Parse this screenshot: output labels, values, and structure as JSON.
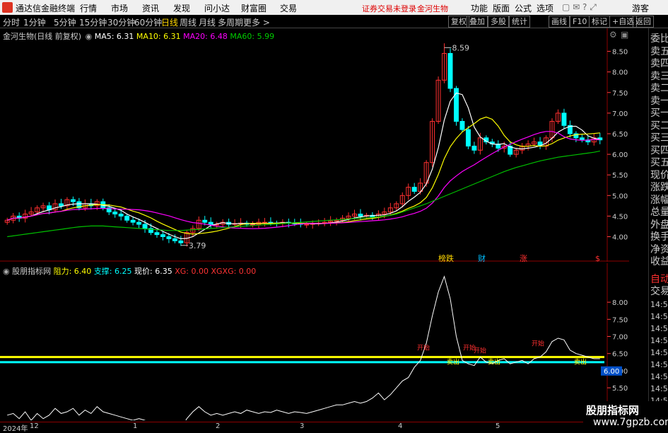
{
  "menu": {
    "app_title": "通达信金融终端",
    "items": [
      "行情",
      "市场",
      "资讯",
      "发现",
      "问小达",
      "财富圈",
      "交易"
    ],
    "notice": "证券交易未登录",
    "stock_link": "金河生物",
    "right_items": [
      "功能",
      "版面",
      "公式",
      "选项"
    ],
    "guest": "游客"
  },
  "timeframes": [
    "分时",
    "1分钟",
    "5分钟",
    "15分钟",
    "30分钟",
    "60分钟",
    "日线",
    "周线",
    "月线",
    "多周期",
    "更多 >"
  ],
  "active_timeframe": "日线",
  "tools": [
    "复权",
    "叠加",
    "多股",
    "统计",
    "画线",
    "F10",
    "标记",
    "+自选",
    "返回"
  ],
  "main_legend": {
    "title": "金河生物(日线 前复权)",
    "ma5": "MA5: 6.31",
    "ma10": "MA10: 6.31",
    "ma20": "MA20: 6.48",
    "ma60": "MA60: 5.99"
  },
  "annotations": {
    "high": "8.59",
    "low": "3.79"
  },
  "event_markers": [
    "榜跌",
    "财",
    "涨",
    "$"
  ],
  "indicator_legend": {
    "name": "股朋指标网",
    "resist": "阻力: 6.40",
    "support": "支撑: 6.25",
    "price": "现价: 6.35",
    "xg": "XG: 0.00",
    "xgxg": "XGXG: 0.00"
  },
  "indicator_tags": [
    "开始",
    "开始",
    "开始",
    "开始",
    "卖出",
    "卖出",
    "卖出"
  ],
  "current_value_badge": "6.00",
  "main_y_ticks": [
    "8.50",
    "8.00",
    "7.50",
    "7.00",
    "6.50",
    "6.00",
    "5.50",
    "5.00",
    "4.50",
    "4.00"
  ],
  "ind_y_ticks": [
    "8.00",
    "7.50",
    "7.00",
    "6.50",
    "6.00",
    "5.50",
    "5.00"
  ],
  "right_panel": {
    "order_labels": [
      "委比",
      "卖五",
      "卖四",
      "卖三",
      "卖二",
      "卖一",
      "买一",
      "买二",
      "买三",
      "买四",
      "买五",
      "现价",
      "涨跌",
      "涨幅",
      "总量",
      "外盘",
      "换手",
      "净资",
      "收益"
    ],
    "auto": "自动",
    "trade": "交易",
    "ticks": [
      "14:56",
      "14:56",
      "14:56",
      "14:56",
      "14:56",
      "14:56",
      "14:56",
      "14:56",
      "14:56",
      "14:56",
      "14:56"
    ]
  },
  "bottom_dates": [
    "2024年",
    "12",
    "1",
    "2",
    "3",
    "4",
    "5"
  ],
  "watermark": {
    "name": "股朋指标网",
    "url": "www.7gpzb.com"
  },
  "colors": {
    "up": "#ff3030",
    "down": "#00ffff",
    "ma5": "#ffffff",
    "ma10": "#ffff00",
    "ma20": "#ff00ff",
    "ma60": "#00c000",
    "resist": "#ffff00",
    "support": "#00ffff",
    "tick": "#ff4040",
    "accent": "#ff3030"
  },
  "chart_data": {
    "type": "candlestick",
    "price_range": [
      3.7,
      8.75
    ],
    "closes": [
      4.4,
      4.5,
      4.45,
      4.55,
      4.6,
      4.7,
      4.75,
      4.65,
      4.8,
      4.75,
      4.9,
      4.85,
      4.7,
      4.8,
      4.75,
      4.85,
      4.7,
      4.6,
      4.55,
      4.5,
      4.4,
      4.35,
      4.3,
      4.2,
      4.1,
      4.05,
      4.0,
      3.95,
      3.9,
      3.85,
      4.1,
      4.2,
      4.4,
      4.35,
      4.3,
      4.3,
      4.35,
      4.3,
      4.32,
      4.33,
      4.3,
      4.3,
      4.35,
      4.35,
      4.33,
      4.32,
      4.35,
      4.33,
      4.32,
      4.3,
      4.3,
      4.32,
      4.33,
      4.35,
      4.38,
      4.4,
      4.45,
      4.5,
      4.55,
      4.5,
      4.52,
      4.48,
      4.55,
      4.6,
      4.7,
      4.8,
      5.0,
      5.2,
      5.1,
      5.3,
      5.8,
      6.8,
      7.8,
      8.45,
      7.6,
      6.8,
      6.6,
      6.2,
      6.1,
      6.4,
      6.3,
      6.25,
      6.15,
      6.2,
      6.0,
      6.1,
      6.2,
      6.25,
      6.3,
      6.2,
      6.4,
      6.8,
      7.0,
      6.7,
      6.5,
      6.4,
      6.35,
      6.3,
      6.4,
      6.35
    ],
    "ma60": [
      4.0,
      4.02,
      4.04,
      4.06,
      4.08,
      4.1,
      4.12,
      4.14,
      4.16,
      4.18,
      4.2,
      4.22,
      4.24,
      4.25,
      4.26,
      4.26,
      4.26,
      4.25,
      4.24,
      4.23,
      4.22,
      4.21,
      4.2,
      4.19,
      4.18,
      4.17,
      4.16,
      4.15,
      4.15,
      4.15,
      4.16,
      4.17,
      4.18,
      4.19,
      4.2,
      4.21,
      4.22,
      4.23,
      4.24,
      4.25,
      4.26,
      4.27,
      4.28,
      4.29,
      4.3,
      4.31,
      4.32,
      4.33,
      4.34,
      4.35,
      4.36,
      4.37,
      4.38,
      4.39,
      4.4,
      4.41,
      4.42,
      4.43,
      4.44,
      4.45,
      4.46,
      4.47,
      4.48,
      4.5,
      4.52,
      4.55,
      4.6,
      4.65,
      4.7,
      4.75,
      4.8,
      4.86,
      4.92,
      4.98,
      5.04,
      5.1,
      5.16,
      5.22,
      5.28,
      5.34,
      5.4,
      5.46,
      5.52,
      5.58,
      5.63,
      5.68,
      5.72,
      5.76,
      5.8,
      5.84,
      5.87,
      5.9,
      5.93,
      5.95,
      5.97,
      5.99,
      6.01,
      6.03,
      6.05,
      6.08
    ],
    "indicator_price": [
      4.7,
      4.75,
      4.6,
      4.8,
      4.55,
      4.75,
      4.6,
      4.7,
      4.9,
      4.75,
      4.8,
      4.9,
      4.7,
      4.85,
      4.75,
      4.95,
      4.8,
      4.75,
      4.7,
      4.65,
      4.6,
      4.55,
      4.6,
      4.55,
      4.45,
      4.4,
      4.35,
      4.3,
      4.35,
      4.3,
      4.6,
      4.8,
      4.95,
      4.8,
      4.7,
      4.75,
      4.7,
      4.75,
      4.8,
      4.75,
      4.85,
      4.8,
      4.75,
      4.8,
      4.78,
      4.85,
      4.8,
      4.75,
      4.8,
      4.78,
      4.75,
      4.8,
      4.85,
      4.9,
      4.95,
      5.0,
      5.0,
      5.05,
      5.1,
      5.05,
      5.1,
      5.2,
      5.35,
      5.15,
      5.3,
      5.5,
      5.7,
      5.8,
      6.1,
      6.3,
      6.8,
      7.6,
      8.3,
      8.75,
      8.1,
      7.0,
      6.3,
      6.2,
      6.15,
      6.4,
      6.25,
      6.2,
      6.3,
      6.35,
      6.2,
      6.25,
      6.3,
      6.2,
      6.35,
      6.4,
      6.55,
      6.85,
      6.95,
      6.9,
      6.6,
      6.5,
      6.45,
      6.4,
      6.35,
      6.35
    ],
    "indicator_range": [
      4.8,
      8.85
    ],
    "resist": 6.4,
    "support": 6.25,
    "high_label": 8.59,
    "low_label": 3.79
  }
}
